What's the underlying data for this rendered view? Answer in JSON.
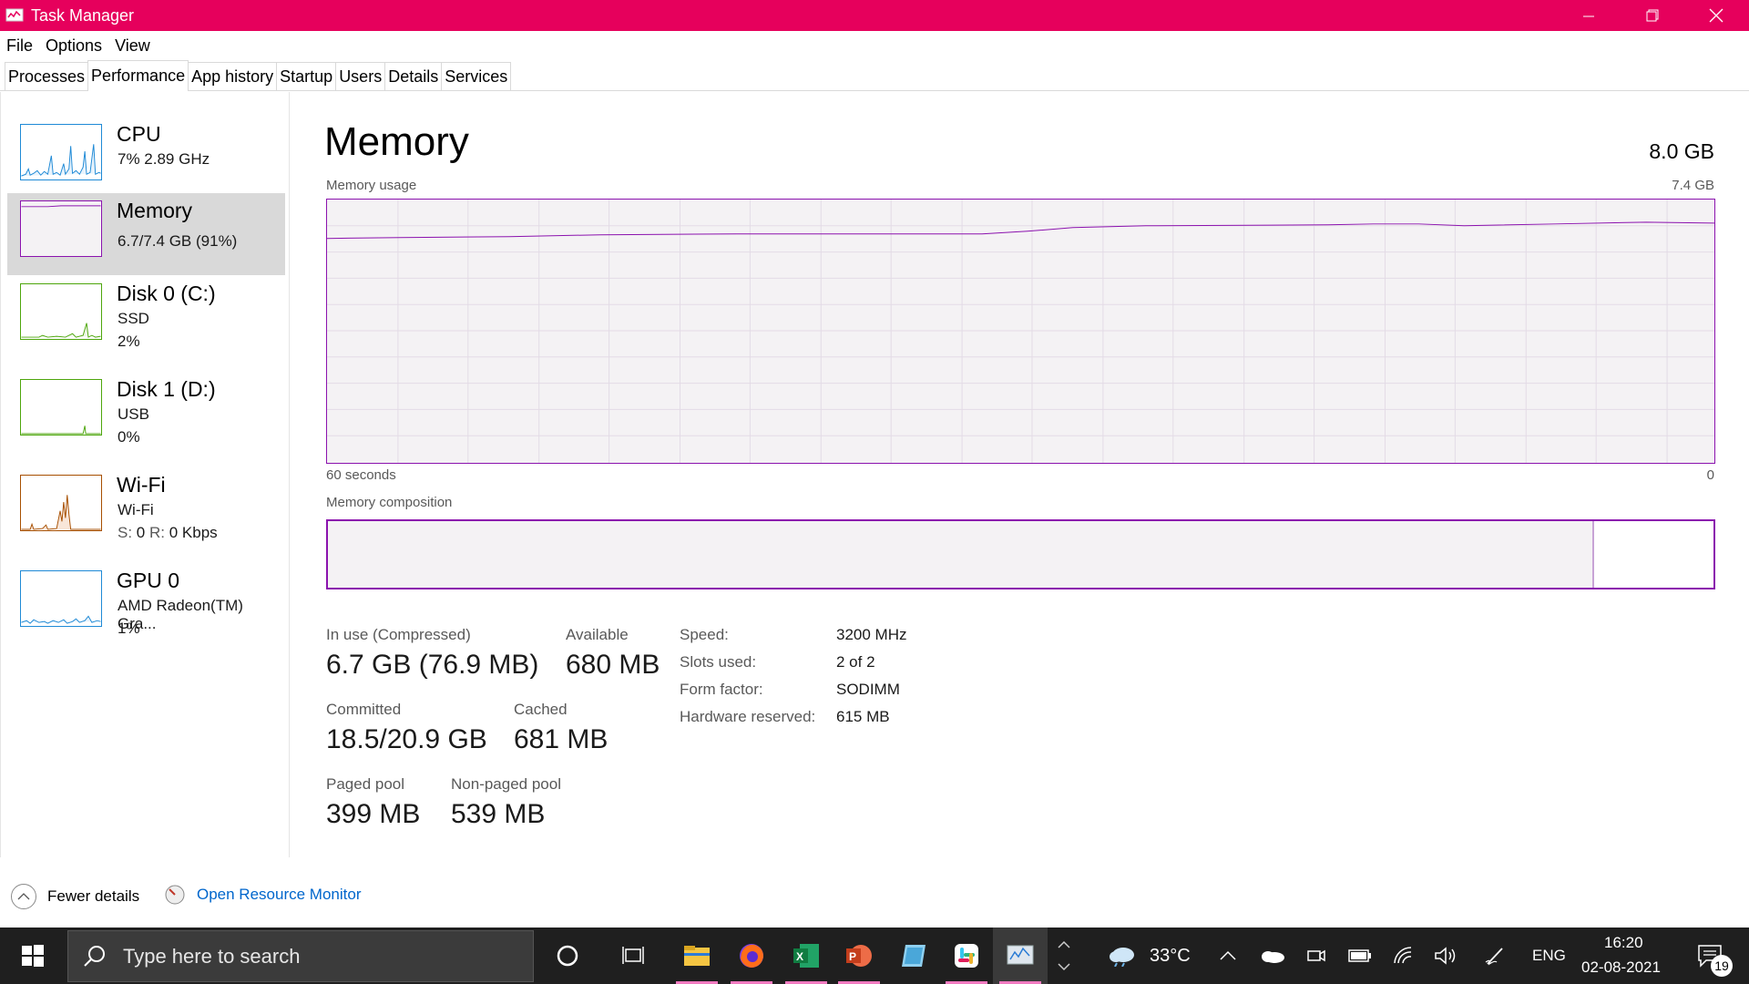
{
  "window": {
    "title": "Task Manager",
    "accent_color": "#e6005c"
  },
  "menu": [
    "File",
    "Options",
    "View"
  ],
  "tabs": [
    "Processes",
    "Performance",
    "App history",
    "Startup",
    "Users",
    "Details",
    "Services"
  ],
  "active_tab": "Performance",
  "sidebar": {
    "items": [
      {
        "title": "CPU",
        "sub1": "7%  2.89 GHz",
        "sub2": "",
        "color": "#1f8ad6"
      },
      {
        "title": "Memory",
        "sub1": "6.7/7.4 GB (91%)",
        "sub2": "",
        "color": "#8b12ae"
      },
      {
        "title": "Disk 0 (C:)",
        "sub1": "SSD",
        "sub2": "2%",
        "color": "#4da60c"
      },
      {
        "title": "Disk 1 (D:)",
        "sub1": "USB",
        "sub2": "0%",
        "color": "#4da60c"
      },
      {
        "title": "Wi-Fi",
        "sub1": "Wi-Fi",
        "sub2_s_label": "S:",
        "sub2_s_val": "0",
        "sub2_r_label": "R:",
        "sub2_r_val": "0 Kbps",
        "color": "#a74f01"
      },
      {
        "title": "GPU 0",
        "sub1": "AMD Radeon(TM) Gra...",
        "sub2": "1%",
        "color": "#1f8ad6"
      }
    ]
  },
  "main": {
    "title": "Memory",
    "total": "8.0 GB",
    "usage_label": "Memory usage",
    "usage_max": "7.4 GB",
    "time_left": "60 seconds",
    "time_right": "0",
    "composition_label": "Memory composition",
    "usage_fraction": 0.91,
    "in_use_label": "In use (Compressed)",
    "in_use_val": "6.7 GB (76.9 MB)",
    "available_label": "Available",
    "available_val": "680 MB",
    "committed_label": "Committed",
    "committed_val": "18.5/20.9 GB",
    "cached_label": "Cached",
    "cached_val": "681 MB",
    "paged_label": "Paged pool",
    "paged_val": "399 MB",
    "nonpaged_label": "Non-paged pool",
    "nonpaged_val": "539 MB",
    "speed_label": "Speed:",
    "speed_val": "3200 MHz",
    "slots_label": "Slots used:",
    "slots_val": "2 of 2",
    "form_label": "Form factor:",
    "form_val": "SODIMM",
    "hw_label": "Hardware reserved:",
    "hw_val": "615 MB"
  },
  "footer": {
    "fewer": "Fewer details",
    "resource": "Open Resource Monitor"
  },
  "taskbar": {
    "search_placeholder": "Type here to search",
    "weather": "33°C",
    "lang": "ENG",
    "time": "16:20",
    "date": "02-08-2021",
    "notifications": "19"
  }
}
